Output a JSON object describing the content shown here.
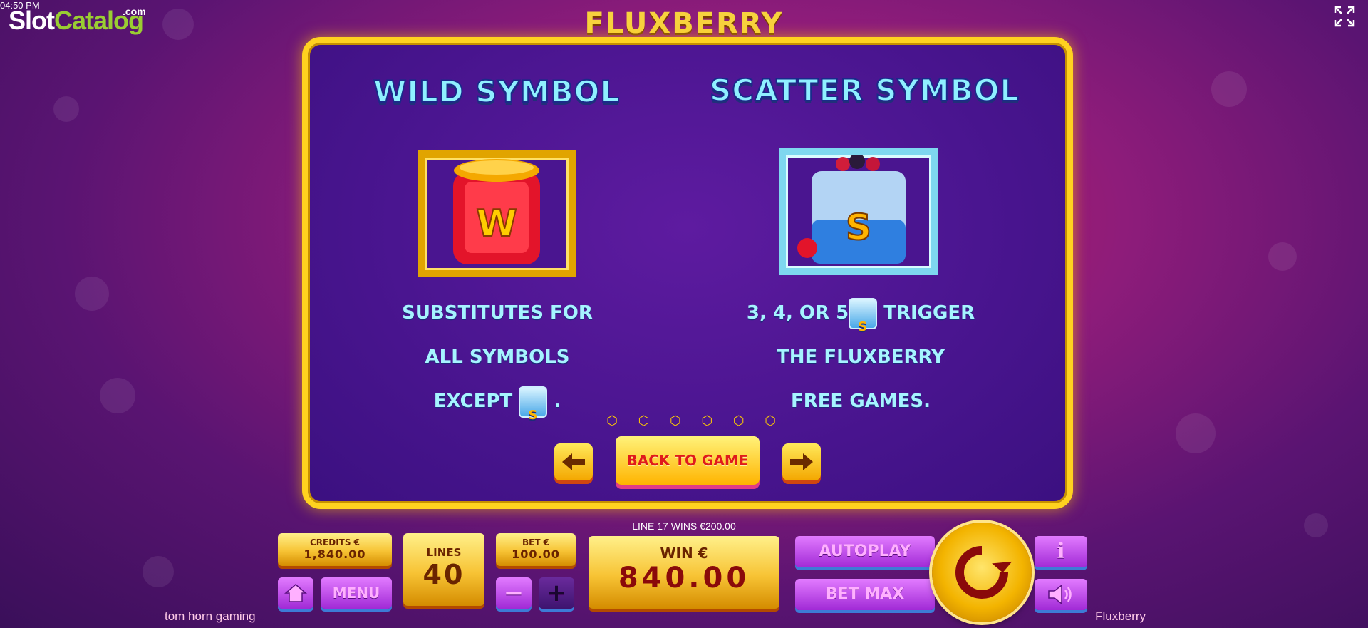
{
  "status_bar": {
    "clock": "04:50 PM"
  },
  "watermark": {
    "brand_main": "Slot",
    "brand_accent": "Catalog",
    "brand_suffix": ".com"
  },
  "game_title": "FLUXBERRY",
  "info_panel": {
    "wild": {
      "heading": "WILD SYMBOL",
      "symbol_letter": "W",
      "lines": [
        "SUBSTITUTES FOR",
        "ALL SYMBOLS",
        "EXCEPT",
        "."
      ]
    },
    "scatter": {
      "heading": "SCATTER SYMBOL",
      "symbol_letter": "S",
      "lines": [
        "3, 4, OR 5",
        "TRIGGER",
        "THE FLUXBERRY",
        "FREE GAMES."
      ]
    },
    "pager": {
      "page_count": 6
    },
    "back_button_label": "BACK TO GAME",
    "prev_icon": "arrow-left-icon",
    "next_icon": "arrow-right-icon"
  },
  "bottom_bar": {
    "credits_label": "CREDITS €",
    "credits_value": "1,840.00",
    "lines_label": "LINES",
    "lines_value": "40",
    "bet_label": "BET €",
    "bet_value": "100.00",
    "last_win_text": "LINE 17 WINS €200.00",
    "win_label": "WIN €",
    "win_value": "840.00",
    "autoplay_label": "AUTOPLAY",
    "bet_max_label": "BET MAX",
    "menu_label": "MENU",
    "minus_label": "−",
    "plus_label": "+",
    "info_label": "i"
  },
  "footer": {
    "provider": "tom horn gaming",
    "game_name": "Fluxberry"
  }
}
